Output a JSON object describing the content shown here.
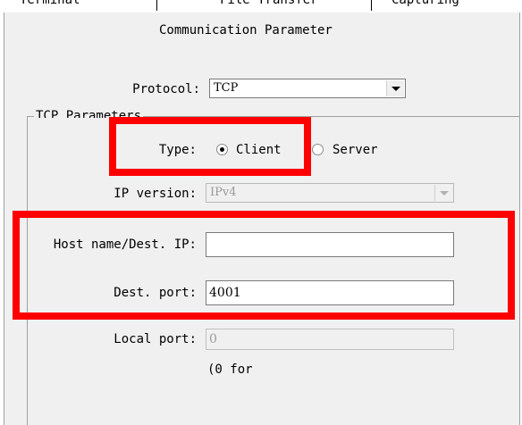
{
  "tabs": [
    "Terminal",
    "File Transfer",
    "Capturing"
  ],
  "title": "Communication Parameter",
  "protocol": {
    "label": "Protocol:",
    "value": "TCP"
  },
  "tcp_group_title": "TCP Parameters",
  "type": {
    "label": "Type:",
    "options": [
      "Client",
      "Server"
    ],
    "selected": "Client"
  },
  "ip_version": {
    "label": "IP version:",
    "value": "IPv4"
  },
  "dest_host": {
    "label": "Host name/Dest. IP:",
    "value": ""
  },
  "dest_port": {
    "label": "Dest. port:",
    "value": "4001"
  },
  "local_port": {
    "label": "Local port:",
    "value": "0"
  },
  "hint": "(0 for",
  "colors": {
    "highlight": "#ff0000",
    "panel": "#f0f0f0"
  }
}
